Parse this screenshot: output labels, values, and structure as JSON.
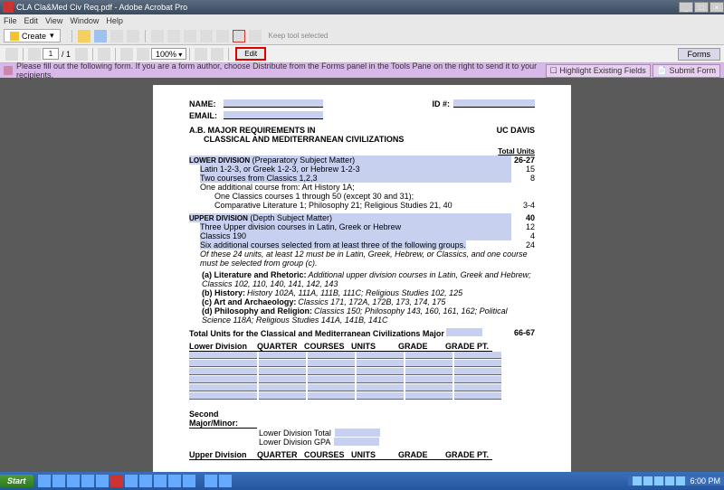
{
  "title": "CLA Cla&Med Civ Req.pdf - Adobe Acrobat Pro",
  "menu": {
    "file": "File",
    "edit": "Edit",
    "view": "View",
    "window": "Window",
    "help": "Help"
  },
  "tb1": {
    "create": "Create",
    "kts": "Keep tool selected"
  },
  "tb2": {
    "page": "1",
    "pages": "/ 1",
    "zoom": "100%",
    "edit": "Edit",
    "forms": "Forms"
  },
  "msg": {
    "text": "Please fill out the following form. If you are a form author, choose Distribute from the Forms panel in the Tools Pane on the right to send it to your recipients.",
    "hef": "Highlight Existing Fields",
    "sf": "Submit Form"
  },
  "doc": {
    "name": "NAME:",
    "id": "ID #:",
    "email": "EMAIL:",
    "h1": "A.B. MAJOR REQUIREMENTS IN",
    "h2": "CLASSICAL AND MEDITERRANEAN CIVILIZATIONS",
    "uc": "UC DAVIS",
    "tu": "Total Units",
    "ld": "LOWER DIVISION",
    "ldp": "(Preparatory Subject Matter)",
    "ldtot": "26-27",
    "ld1": "Latin 1-2-3, or Greek 1-2-3, or Hebrew 1-2-3",
    "ld1u": "15",
    "ld2": "Two courses from Classics 1,2,3",
    "ld2u": "8",
    "ld3": "One additional course from:  Art History 1A;",
    "ld3b": "One Classics courses 1 through 50 (except 30 and 31);",
    "ld3c": "Comparative Literature 1; Philosophy 21; Religious Studies 21, 40",
    "ld3u": "3-4",
    "ud": "UPPER DIVISION",
    "udp": "(Depth Subject Matter)",
    "udtot": "40",
    "ud1": "Three Upper division courses in Latin, Greek or Hebrew",
    "ud1u": "12",
    "ud2": "Classics 190",
    "ud2u": "4",
    "ud3": "Six additional courses selected from at least three of the following groups.",
    "ud3u": "24",
    "ud3n": "Of these 24 units, at least 12 must be in Latin, Greek, Hebrew, or Classics, and one course must be selected from group (c).",
    "ga": "(a)  Literature and Rhetoric:",
    "gat": "Additional upper division courses in Latin, Greek and Hebrew; Classics 102, 110, 140, 141, 142, 143",
    "gb": "(b)  History:",
    "gbt": "History 102A, 111A, 111B, 111C; Religious Studies 102, 125",
    "gc": "(c)  Art and Archaeology:",
    "gct": "Classics 171, 172A, 172B, 173, 174, 175",
    "gd": "(d)  Philosophy and Religion:",
    "gdt": "Classics 150; Philosophy 143, 160, 161, 162; Political Science 118A; Religious Studies 141A, 141B, 141C",
    "tot": "Total Units for the Classical and Mediterranean Civilizations Major",
    "totu": "66-67",
    "ldiv": "Lower Division",
    "q": "QUARTER",
    "c": "COURSES",
    "u": "UNITS",
    "g": "GRADE",
    "gp": "GRADE PT.",
    "smm": "Second Major/Minor:",
    "ldt": "Lower Division Total",
    "ldg": "Lower Division GPA",
    "udiv": "Upper Division"
  },
  "task": {
    "start": "Start",
    "time": "6:00 PM"
  }
}
